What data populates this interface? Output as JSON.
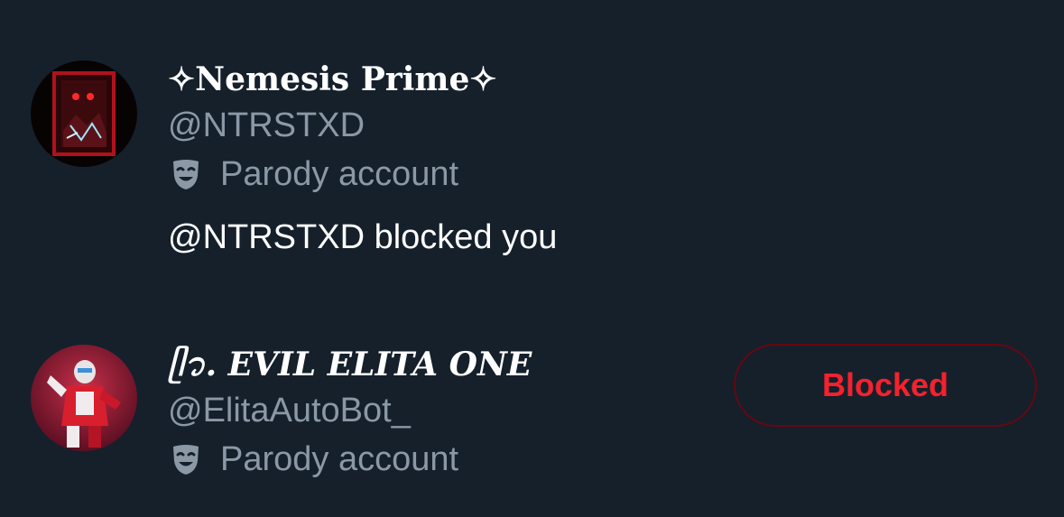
{
  "entries": [
    {
      "display_name": "✧Nemesis Prime✧",
      "handle": "@NTRSTXD",
      "parody_label": "Parody account",
      "parody_icon": "theater-mask-icon",
      "status": "@NTRSTXD blocked you"
    },
    {
      "display_name": "ᥫ᭡. EVIL ELITA ONE",
      "handle": "@ElitaAutoBot_",
      "parody_label": "Parody account",
      "parody_icon": "theater-mask-icon",
      "button_label": "Blocked"
    }
  ],
  "colors": {
    "background": "#15202b",
    "secondary_text": "#8b98a5",
    "blocked_red": "#f4212e"
  }
}
